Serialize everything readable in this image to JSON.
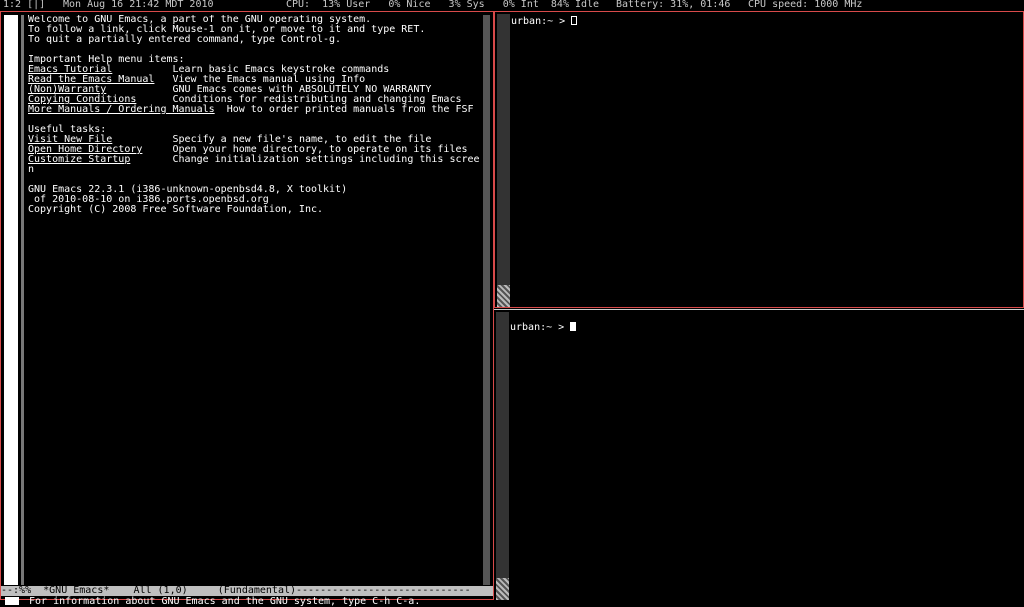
{
  "statusbar": {
    "workspace": "1:2 [|]",
    "datetime": "Mon Aug 16 21:42 MDT 2010",
    "cpu": "CPU:  13% User   0% Nice   3% Sys   0% Int  84% Idle",
    "battery": "Battery: 31%, 01:46",
    "cpu_speed": "CPU speed: 1000 MHz"
  },
  "emacs": {
    "lines": [
      {
        "text": "Welcome to GNU Emacs, a part of the GNU operating system."
      },
      {
        "text": "To follow a link, click Mouse-1 on it, or move to it and type RET."
      },
      {
        "text": "To quit a partially entered command, type Control-g."
      },
      {
        "text": ""
      },
      {
        "text": "Important Help menu items:"
      },
      {
        "link": "Emacs Tutorial",
        "pad": "          ",
        "desc": "Learn basic Emacs keystroke commands"
      },
      {
        "link": "Read the Emacs Manual",
        "pad": "   ",
        "desc": "View the Emacs manual using Info"
      },
      {
        "link": "(Non)Warranty",
        "pad": "           ",
        "desc": "GNU Emacs comes with ABSOLUTELY NO WARRANTY"
      },
      {
        "link": "Copying Conditions",
        "pad": "      ",
        "desc": "Conditions for redistributing and changing Emacs"
      },
      {
        "link": "More Manuals / Ordering Manuals",
        "pad": "  ",
        "desc": "How to order printed manuals from the FSF"
      },
      {
        "text": ""
      },
      {
        "text": "Useful tasks:"
      },
      {
        "link": "Visit New File",
        "pad": "          ",
        "desc": "Specify a new file's name, to edit the file"
      },
      {
        "link": "Open Home Directory",
        "pad": "     ",
        "desc": "Open your home directory, to operate on its files"
      },
      {
        "link": "Customize Startup",
        "pad": "       ",
        "desc": "Change initialization settings including this scree"
      },
      {
        "text": "n"
      },
      {
        "text": ""
      },
      {
        "text": "GNU Emacs 22.3.1 (i386-unknown-openbsd4.8, X toolkit)"
      },
      {
        "text": " of 2010-08-10 on i386.ports.openbsd.org"
      },
      {
        "text": "Copyright (C) 2008 Free Software Foundation, Inc."
      }
    ],
    "modeline": "--:%%  *GNU Emacs*    All (1,0)     (Fundamental)-----------------------------",
    "minibuffer": "For information about GNU Emacs and the GNU system, type C-h C-a."
  },
  "terminals": {
    "top_prompt": "urban:~ > ",
    "bottom_prompt": "urban:~ > "
  }
}
